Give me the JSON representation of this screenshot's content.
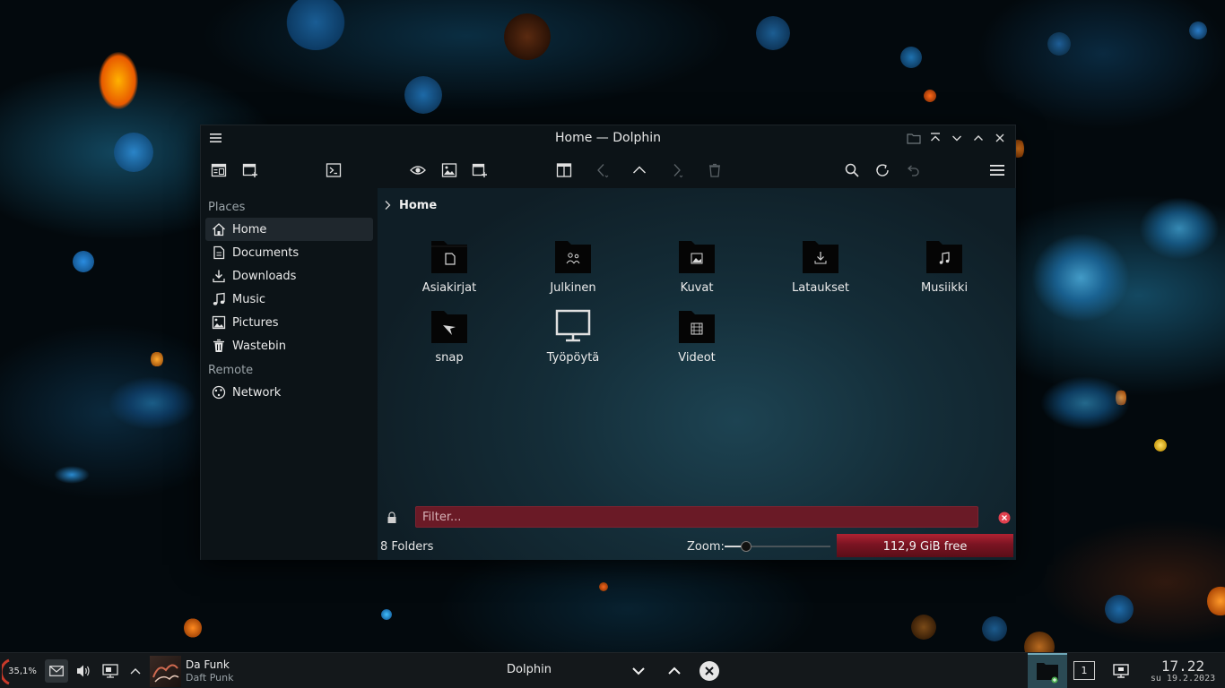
{
  "window": {
    "title": "Home — Dolphin"
  },
  "sidebar": {
    "places_header": "Places",
    "places": [
      {
        "label": "Home",
        "icon": "home-icon",
        "active": true
      },
      {
        "label": "Documents",
        "icon": "document-icon"
      },
      {
        "label": "Downloads",
        "icon": "download-icon"
      },
      {
        "label": "Music",
        "icon": "music-icon"
      },
      {
        "label": "Pictures",
        "icon": "image-icon"
      },
      {
        "label": "Wastebin",
        "icon": "trash-icon"
      }
    ],
    "remote_header": "Remote",
    "remote": [
      {
        "label": "Network",
        "icon": "network-icon"
      }
    ]
  },
  "breadcrumb": {
    "current": "Home"
  },
  "files": [
    {
      "label": "Asiakirjat",
      "icon": "folder-document-icon"
    },
    {
      "label": "Julkinen",
      "icon": "folder-public-icon"
    },
    {
      "label": "Kuvat",
      "icon": "folder-pictures-icon"
    },
    {
      "label": "Lataukset",
      "icon": "folder-download-icon"
    },
    {
      "label": "Musiikki",
      "icon": "folder-music-icon"
    },
    {
      "label": "snap",
      "icon": "folder-snap-icon"
    },
    {
      "label": "Työpöytä",
      "icon": "desktop-icon"
    },
    {
      "label": "Videot",
      "icon": "folder-video-icon"
    }
  ],
  "filter": {
    "placeholder": "Filter..."
  },
  "status": {
    "count": "8 Folders",
    "zoom_label": "Zoom:",
    "zoom_level": 0.2,
    "free_space": "112,9 GiB free",
    "usage_fraction": 1.0
  },
  "panel": {
    "battery": "35,1%",
    "media_title": "Da Funk",
    "media_artist": "Daft Punk",
    "task_label": "Dolphin",
    "pager": "1",
    "clock_time": "17.22",
    "clock_date": "su 19.2.2023"
  },
  "colors": {
    "accent_red": "#8b1e2c",
    "view_teal": "#1d4352",
    "window_bg": "#0c1317"
  }
}
